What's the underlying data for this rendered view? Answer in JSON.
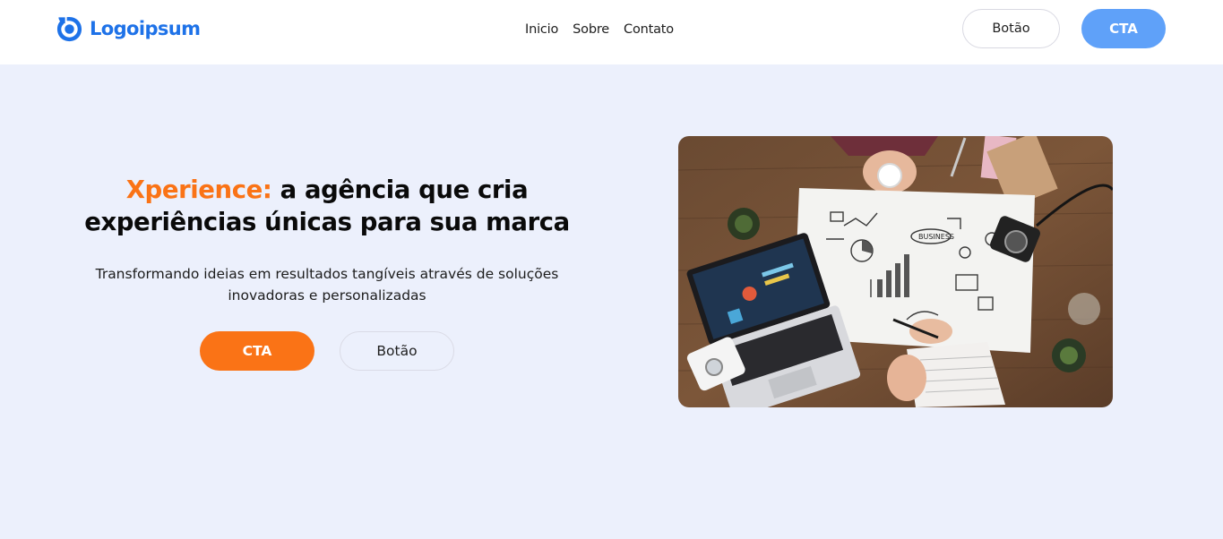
{
  "header": {
    "logo": {
      "text": "Logoipsum",
      "icon": "logo-mark-icon",
      "color": "#1e72e8"
    },
    "nav": [
      {
        "label": "Inicio"
      },
      {
        "label": "Sobre"
      },
      {
        "label": "Contato"
      }
    ],
    "secondary_button": "Botão",
    "cta_button": "CTA"
  },
  "hero": {
    "title_accent": "Xperience:",
    "title_rest": " a agência que cria experiências únicas para sua marca",
    "subtitle": "Transformando ideias em resultados tangíveis através de soluções inovadoras e personalizadas",
    "cta_button": "CTA",
    "secondary_button": "Botão",
    "image": {
      "subject": "team-planning-desk-photo"
    }
  },
  "colors": {
    "page_background": "#ECF0FC",
    "accent_orange": "#fa7316",
    "header_cta_blue": "#5fa1f9",
    "brand_blue": "#1e72e8"
  }
}
